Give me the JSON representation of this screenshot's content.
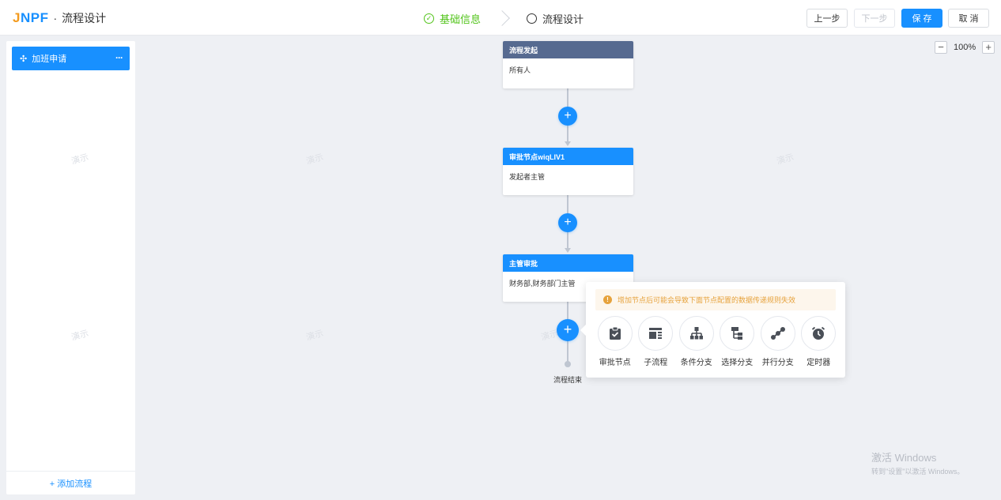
{
  "header": {
    "logo_text": "JNPF",
    "separator": "·",
    "app_title": "流程设计",
    "steps": [
      {
        "label": "基础信息",
        "status": "done"
      },
      {
        "label": "流程设计",
        "status": "active"
      }
    ],
    "buttons": {
      "prev": "上一步",
      "next": "下一步",
      "save": "保 存",
      "cancel": "取 消"
    }
  },
  "sidebar": {
    "flows": [
      {
        "name": "加班申请",
        "more": "···"
      }
    ],
    "add_label": "+ 添加流程"
  },
  "watermark_text": "演示",
  "zoom": {
    "minus": "−",
    "plus": "+",
    "value": "100%"
  },
  "nodes": [
    {
      "title": "流程发起",
      "content": "所有人",
      "color": "#566a90"
    },
    {
      "title": "审批节点wiqLIV1",
      "content": "发起者主管",
      "color": "#1890ff"
    },
    {
      "title": "主管审批",
      "content": "财务部,财务部门主管",
      "color": "#1890ff"
    }
  ],
  "add_node_symbol": "+",
  "end_label": "流程结束",
  "popover": {
    "warning_icon": "!",
    "warning": "增加节点后可能会导致下面节点配置的数据传递规则失效",
    "types": [
      {
        "label": "审批节点",
        "icon": "approval-icon"
      },
      {
        "label": "子流程",
        "icon": "subprocess-icon"
      },
      {
        "label": "条件分支",
        "icon": "condition-branch-icon"
      },
      {
        "label": "选择分支",
        "icon": "choice-branch-icon"
      },
      {
        "label": "并行分支",
        "icon": "parallel-branch-icon"
      },
      {
        "label": "定时器",
        "icon": "timer-icon"
      }
    ]
  },
  "activation": {
    "title": "激活 Windows",
    "subtitle": "转到\"设置\"以激活 Windows。"
  },
  "colors": {
    "primary": "#1890ff",
    "done": "#52c41a",
    "warning": "#e6a23c",
    "start_node": "#566a90"
  }
}
